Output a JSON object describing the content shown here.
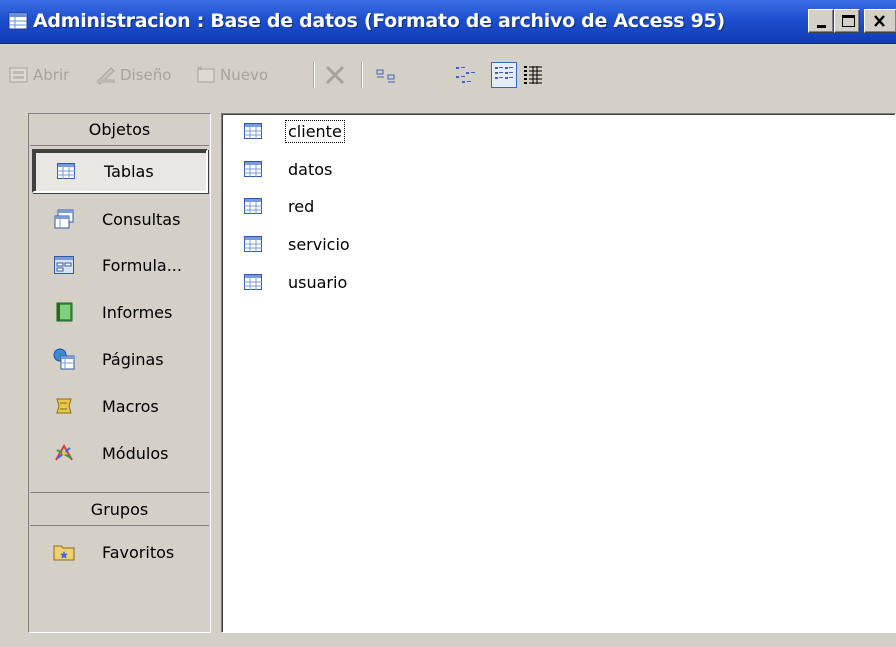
{
  "window": {
    "title": "Administracion : Base de datos (Formato de archivo de Access 95)",
    "controls": {
      "minimize": "minimize-icon",
      "maximize": "maximize-icon",
      "close": "close-icon"
    }
  },
  "toolbar": {
    "open_label": "Abrir",
    "design_label": "Diseño",
    "new_label": "Nuevo",
    "delete_icon": "delete-x-icon",
    "view_buttons": [
      "large-icons-icon",
      "small-icons-icon",
      "list-view-icon",
      "details-view-icon"
    ],
    "active_view": "list-view-icon"
  },
  "objects_bar": {
    "header": "Objetos",
    "items": [
      {
        "label": "Tablas",
        "icon": "table-icon",
        "selected": true
      },
      {
        "label": "Consultas",
        "icon": "query-icon"
      },
      {
        "label": "Formula...",
        "icon": "form-icon"
      },
      {
        "label": "Informes",
        "icon": "report-icon"
      },
      {
        "label": "Páginas",
        "icon": "page-icon"
      },
      {
        "label": "Macros",
        "icon": "macro-icon"
      },
      {
        "label": "Módulos",
        "icon": "module-icon"
      }
    ],
    "groups_header": "Grupos",
    "groups": [
      {
        "label": "Favoritos",
        "icon": "favorites-folder-icon"
      }
    ]
  },
  "tables": [
    {
      "name": "cliente",
      "focused": true
    },
    {
      "name": "datos"
    },
    {
      "name": "red"
    },
    {
      "name": "servicio"
    },
    {
      "name": "usuario"
    }
  ],
  "colors": {
    "titlebar": "#1e4fcf",
    "face": "#d4d0c8",
    "selection_border": "#316ac5"
  }
}
